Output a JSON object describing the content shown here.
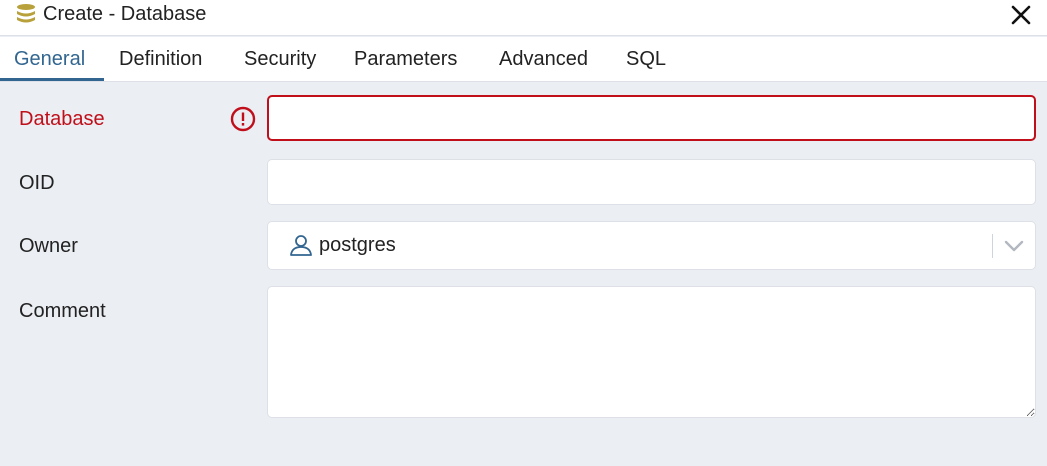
{
  "dialog": {
    "title": "Create - Database",
    "icon": "database-icon",
    "close": "close-icon"
  },
  "tabs": [
    {
      "label": "General",
      "active": true
    },
    {
      "label": "Definition",
      "active": false
    },
    {
      "label": "Security",
      "active": false
    },
    {
      "label": "Parameters",
      "active": false
    },
    {
      "label": "Advanced",
      "active": false
    },
    {
      "label": "SQL",
      "active": false
    }
  ],
  "form": {
    "database": {
      "label": "Database",
      "value": "",
      "status": "error"
    },
    "oid": {
      "label": "OID",
      "value": ""
    },
    "owner": {
      "label": "Owner",
      "value": "postgres",
      "icon": "user-icon"
    },
    "comment": {
      "label": "Comment",
      "value": ""
    }
  },
  "colors": {
    "accent": "#326690",
    "error": "#c00f1a",
    "background": "#ebeef3",
    "icon_gold": "#b8a13a"
  }
}
